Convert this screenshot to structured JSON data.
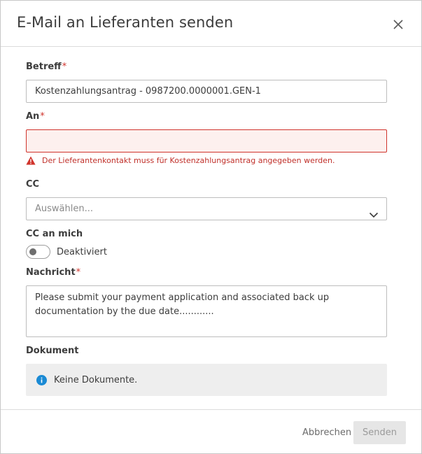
{
  "dialog": {
    "title": "E-Mail an Lieferanten senden",
    "close_icon": "close-icon"
  },
  "form": {
    "subject": {
      "label": "Betreff",
      "required_mark": "*",
      "value": "Kostenzahlungsantrag - 0987200.0000001.GEN-1"
    },
    "to": {
      "label": "An",
      "required_mark": "*",
      "value": "",
      "error_icon": "warning-icon",
      "error": "Der Lieferantenkontakt muss für Kostenzahlungsantrag angegeben werden."
    },
    "cc": {
      "label": "CC",
      "placeholder": "Auswählen...",
      "chevron_icon": "chevron-down-icon"
    },
    "cc_me": {
      "label": "CC an mich",
      "state": "Deaktiviert",
      "enabled": false
    },
    "message": {
      "label": "Nachricht",
      "required_mark": "*",
      "value": "Please submit your payment application and associated back up documentation by the due date............"
    },
    "document": {
      "label": "Dokument",
      "info_icon": "info-icon",
      "empty_text": "Keine Dokumente."
    }
  },
  "footer": {
    "cancel_label": "Abbrechen",
    "send_label": "Senden"
  },
  "colors": {
    "error": "#d0342c",
    "info": "#1a8ad4",
    "disabled_button_bg": "#e6e6e6"
  }
}
